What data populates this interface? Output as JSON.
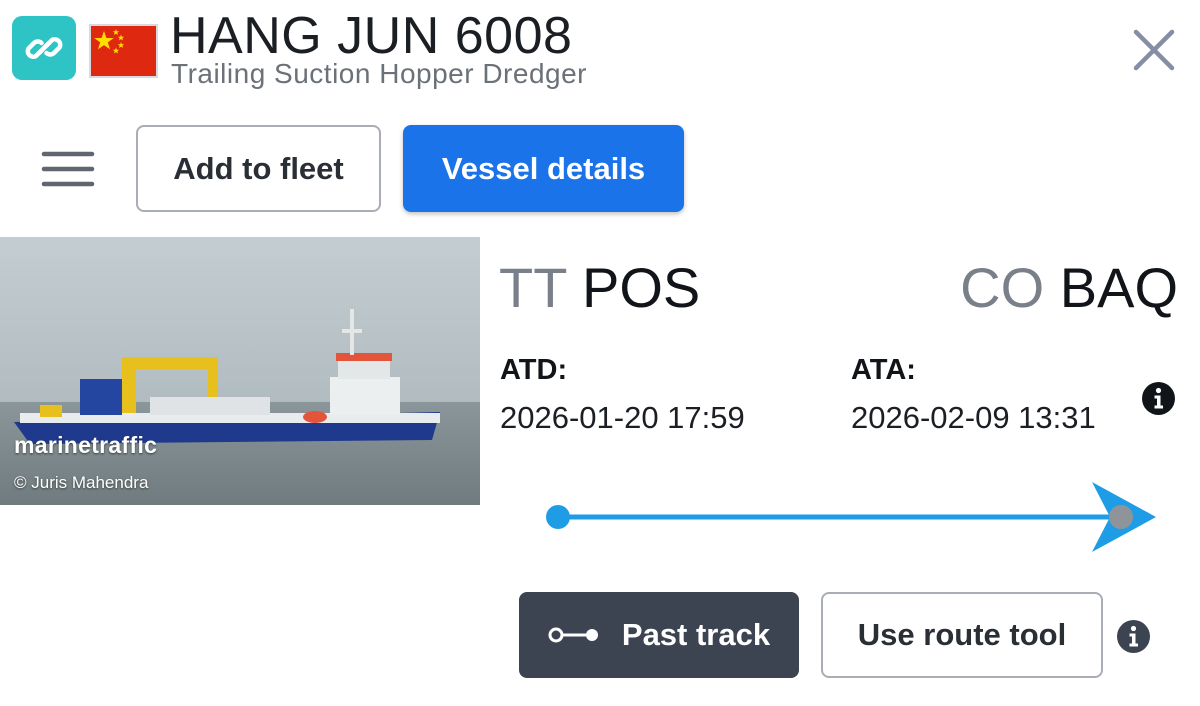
{
  "header": {
    "vessel_name": "HANG JUN 6008",
    "vessel_type": "Trailing Suction Hopper Dredger",
    "link_icon": "link-icon",
    "flag_country": "CN",
    "close_icon": "close-icon"
  },
  "actions": {
    "menu_icon": "hamburger-menu-icon",
    "add_to_fleet_label": "Add to fleet",
    "vessel_details_label": "Vessel details"
  },
  "photo": {
    "watermark": "marinetraffic",
    "credit": "© Juris Mahendra"
  },
  "voyage": {
    "departure": {
      "country_code": "TT",
      "port_code": "POS",
      "label": "ATD:",
      "time": "2026-01-20 17:59"
    },
    "arrival": {
      "country_code": "CO",
      "port_code": "BAQ",
      "label": "ATA:",
      "time": "2026-02-09 13:31"
    },
    "progress_fraction": 1.0
  },
  "track": {
    "past_track_label": "Past track",
    "route_tool_label": "Use route tool"
  },
  "colors": {
    "accent_blue": "#1a73e8",
    "progress_blue": "#1e9de6",
    "link_teal": "#2ec4c6",
    "dark_button": "#3d4451",
    "flag_red": "#de2910",
    "flag_yellow": "#ffde00"
  }
}
